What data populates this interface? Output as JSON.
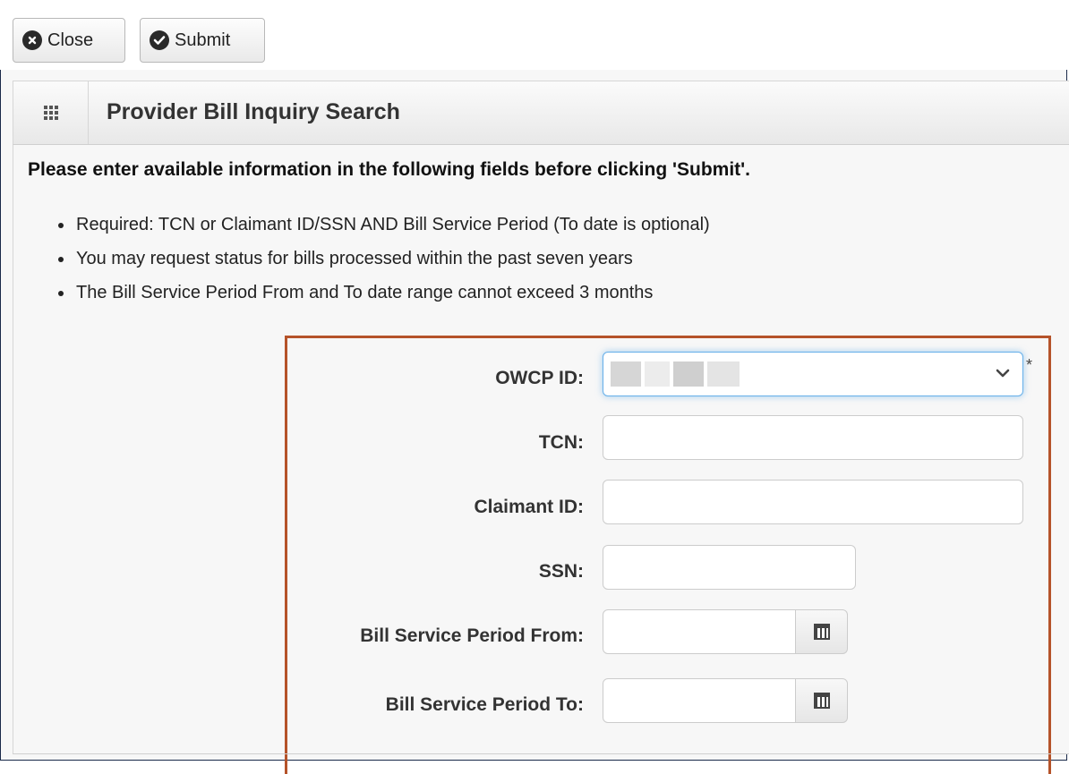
{
  "toolbar": {
    "close_label": "Close",
    "submit_label": "Submit"
  },
  "panel": {
    "title": "Provider Bill Inquiry Search"
  },
  "instructions": {
    "intro": "Please enter available information in the following fields before clicking 'Submit'.",
    "bullets": [
      "Required: TCN or Claimant ID/SSN AND Bill Service Period (To date is optional)",
      "You may request status for bills processed within the past seven years",
      "The Bill Service Period From and To date range cannot exceed 3 months"
    ]
  },
  "form": {
    "owcp_id_label": "OWCP ID:",
    "owcp_required_marker": "*",
    "tcn_label": "TCN:",
    "claimant_id_label": "Claimant ID:",
    "ssn_label": "SSN:",
    "period_from_label": "Bill Service Period From:",
    "period_to_label": "Bill Service Period To:"
  },
  "icons": {
    "close": "close-circle-icon",
    "submit": "check-circle-icon",
    "panel_menu": "grid-icon",
    "dropdown": "chevron-down-icon",
    "calendar": "calendar-icon"
  },
  "colors": {
    "highlight_border": "#b5532a",
    "focus_glow": "#66afe9"
  }
}
